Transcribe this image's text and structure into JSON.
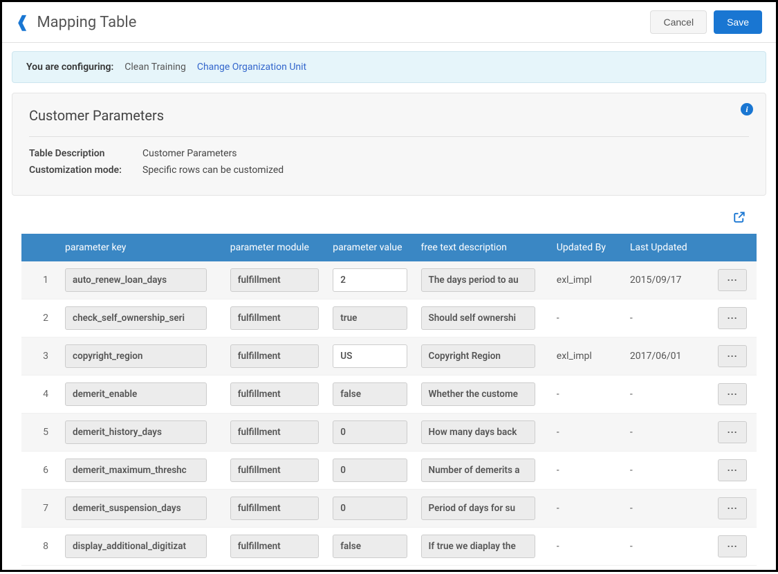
{
  "header": {
    "title": "Mapping Table",
    "cancel": "Cancel",
    "save": "Save"
  },
  "banner": {
    "label": "You are configuring:",
    "org": "Clean Training",
    "link": "Change Organization Unit"
  },
  "section": {
    "title": "Customer Parameters",
    "desc_label": "Table Description",
    "desc_value": "Customer Parameters",
    "mode_label": "Customization mode:",
    "mode_value": "Specific rows can be customized"
  },
  "table": {
    "headers": {
      "key": "parameter key",
      "module": "parameter module",
      "value": "parameter value",
      "desc": "free text description",
      "updated_by": "Updated By",
      "last_updated": "Last Updated"
    },
    "rows": [
      {
        "n": "1",
        "key": "auto_renew_loan_days",
        "module": "fulfillment",
        "value": "2",
        "value_editable": true,
        "desc": "The days period to au",
        "updated_by": "exl_impl",
        "last_updated": "2015/09/17"
      },
      {
        "n": "2",
        "key": "check_self_ownership_seri",
        "module": "fulfillment",
        "value": "true",
        "value_editable": false,
        "desc": "Should self ownershi",
        "updated_by": "-",
        "last_updated": "-"
      },
      {
        "n": "3",
        "key": "copyright_region",
        "module": "fulfillment",
        "value": "US",
        "value_editable": true,
        "desc": "Copyright Region",
        "updated_by": "exl_impl",
        "last_updated": "2017/06/01"
      },
      {
        "n": "4",
        "key": "demerit_enable",
        "module": "fulfillment",
        "value": "false",
        "value_editable": false,
        "desc": "Whether the custome",
        "updated_by": "-",
        "last_updated": "-"
      },
      {
        "n": "5",
        "key": "demerit_history_days",
        "module": "fulfillment",
        "value": "0",
        "value_editable": false,
        "desc": "How many days back",
        "updated_by": "-",
        "last_updated": "-"
      },
      {
        "n": "6",
        "key": "demerit_maximum_threshc",
        "module": "fulfillment",
        "value": "0",
        "value_editable": false,
        "desc": "Number of demerits a",
        "updated_by": "-",
        "last_updated": "-"
      },
      {
        "n": "7",
        "key": "demerit_suspension_days",
        "module": "fulfillment",
        "value": "0",
        "value_editable": false,
        "desc": "Period of days for su",
        "updated_by": "-",
        "last_updated": "-"
      },
      {
        "n": "8",
        "key": "display_additional_digitizat",
        "module": "fulfillment",
        "value": "false",
        "value_editable": false,
        "desc": "If true we diaplay the",
        "updated_by": "-",
        "last_updated": "-"
      }
    ]
  }
}
